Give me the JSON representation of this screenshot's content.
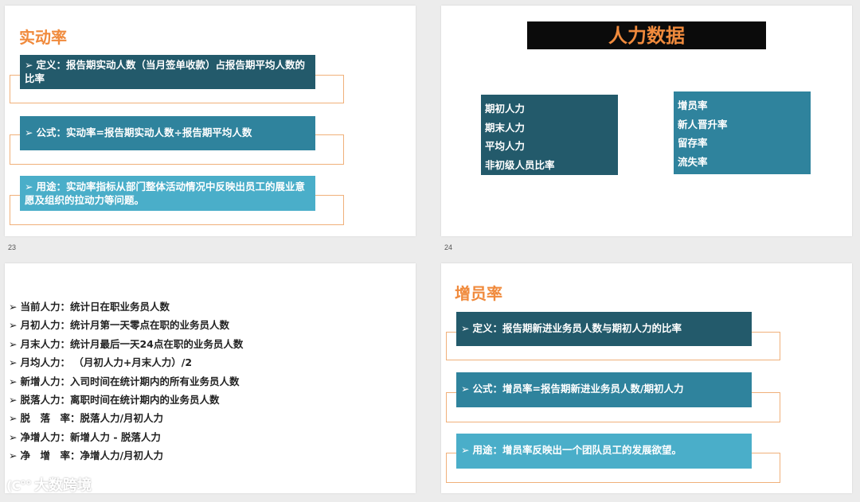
{
  "slide23": {
    "number": "23",
    "title": "实动率",
    "items": [
      {
        "text": "定义：报告期实动人数（当月签单收款）占报告期平均人数的比率"
      },
      {
        "text": "公式：实动率=报告期实动人数÷报告期平均人数"
      },
      {
        "text": "用途：实动率指标从部门整体活动情况中反映出员工的展业意愿及组织的拉动力等问题。"
      }
    ]
  },
  "slide24": {
    "number": "24",
    "banner": "人力数据",
    "left_list": [
      "期初人力",
      "期末人力",
      "平均人力",
      "非初级人员比率"
    ],
    "right_list": [
      "增员率",
      "新人晋升率",
      "留存率",
      "流失率"
    ]
  },
  "slide25": {
    "rows": [
      "当前人力：统计日在职业务员人数",
      "月初人力：统计月第一天零点在职的业务员人数",
      "月末人力：统计月最后一天24点在职的业务员人数",
      "月均人力： （月初人力+月末人力）/2",
      "新增人力：入司时间在统计期内的所有业务员人数",
      "脱落人力：离职时间在统计期内的业务员人数",
      "脱　落　率：脱落人力/月初人力",
      "净增人力：新增人力 - 脱落人力",
      "净　增　率：净增人力/月初人力"
    ]
  },
  "slide26": {
    "title": "增员率",
    "items": [
      {
        "text": "定义：报告期新进业务员人数与期初人力的比率"
      },
      {
        "text": "公式：增员率=报告期新进业务员人数/期初人力"
      },
      {
        "text": "用途：增员率反映出一个团队员工的发展欲望。"
      }
    ]
  },
  "arrow_glyph": "➢",
  "watermark": {
    "logo": "(C°°",
    "text": "大数跨境"
  },
  "colors": {
    "title": "#f08a3c",
    "dark_teal": "#235a6b",
    "mid_teal": "#2f839d",
    "light_teal": "#4aaec9",
    "outline": "#f0b07a"
  }
}
